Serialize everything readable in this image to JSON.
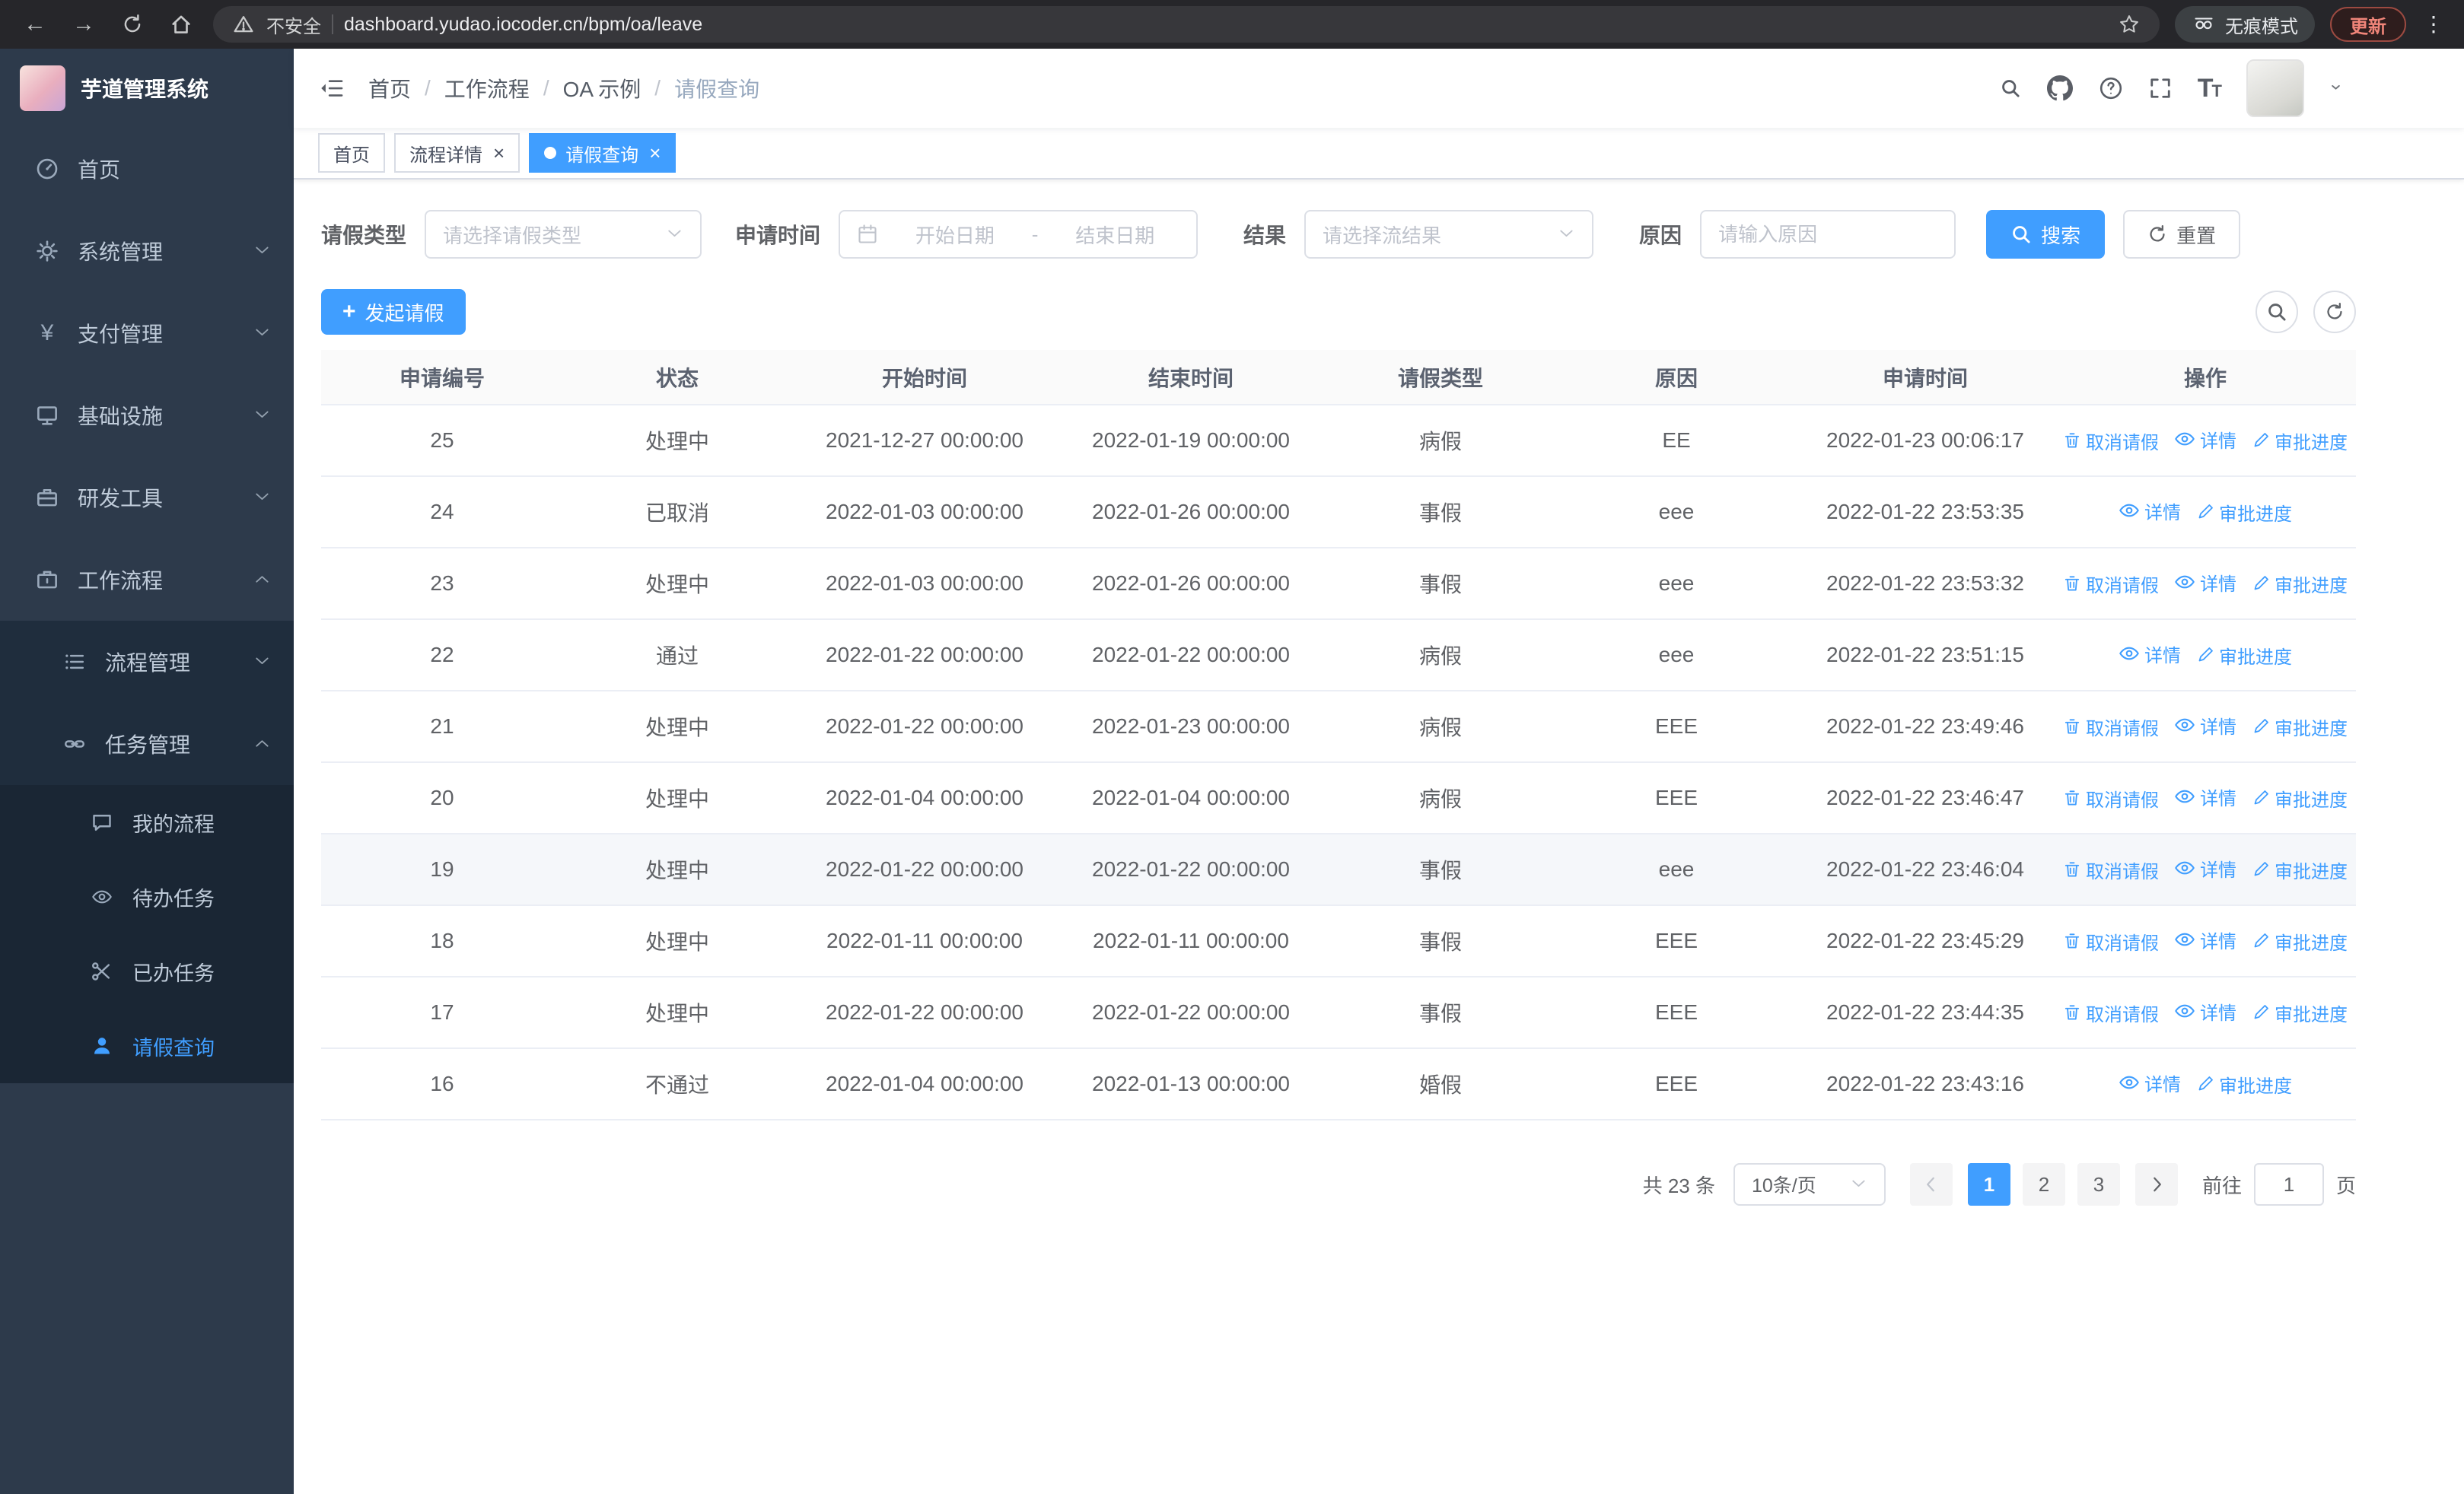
{
  "browser": {
    "security_warning": "不安全",
    "url": "dashboard.yudao.iocoder.cn/bpm/oa/leave",
    "incognito_label": "无痕模式",
    "update_label": "更新"
  },
  "sidebar": {
    "logo_title": "芋道管理系统",
    "menu": [
      {
        "key": "home",
        "label": "首页",
        "icon": "dashboard",
        "level": 1
      },
      {
        "key": "system",
        "label": "系统管理",
        "icon": "gear",
        "level": 1,
        "chevron": "down"
      },
      {
        "key": "payment",
        "label": "支付管理",
        "icon": "yen",
        "level": 1,
        "chevron": "down"
      },
      {
        "key": "infrastructure",
        "label": "基础设施",
        "icon": "monitor",
        "level": 1,
        "chevron": "down"
      },
      {
        "key": "dev-tools",
        "label": "研发工具",
        "icon": "toolbox",
        "level": 1,
        "chevron": "down"
      },
      {
        "key": "workflow",
        "label": "工作流程",
        "icon": "briefcase",
        "level": 1,
        "chevron": "up"
      },
      {
        "key": "process-mgmt",
        "label": "流程管理",
        "icon": "list",
        "level": 2,
        "chevron": "down"
      },
      {
        "key": "task-mgmt",
        "label": "任务管理",
        "icon": "link",
        "level": 2,
        "chevron": "up"
      },
      {
        "key": "my-process",
        "label": "我的流程",
        "icon": "chat",
        "level": 3
      },
      {
        "key": "todo-tasks",
        "label": "待办任务",
        "icon": "eye",
        "level": 3
      },
      {
        "key": "done-tasks",
        "label": "已办任务",
        "icon": "scissors",
        "level": 3
      },
      {
        "key": "leave-query",
        "label": "请假查询",
        "icon": "person",
        "level": 3,
        "active": true
      }
    ]
  },
  "header": {
    "breadcrumbs": [
      "首页",
      "工作流程",
      "OA 示例",
      "请假查询"
    ]
  },
  "tabs": [
    {
      "key": "home",
      "label": "首页",
      "closable": false,
      "active": false
    },
    {
      "key": "process-detail",
      "label": "流程详情",
      "closable": true,
      "active": false
    },
    {
      "key": "leave-query",
      "label": "请假查询",
      "closable": true,
      "active": true
    }
  ],
  "filters": {
    "leave_type_label": "请假类型",
    "leave_type_placeholder": "请选择请假类型",
    "apply_time_label": "申请时间",
    "start_date_placeholder": "开始日期",
    "range_separator": "-",
    "end_date_placeholder": "结束日期",
    "result_label": "结果",
    "result_placeholder": "请选择流结果",
    "reason_label": "原因",
    "reason_placeholder": "请输入原因",
    "search_label": "搜索",
    "reset_label": "重置"
  },
  "toolbar": {
    "create_label": "发起请假"
  },
  "table": {
    "columns": [
      "申请编号",
      "状态",
      "开始时间",
      "结束时间",
      "请假类型",
      "原因",
      "申请时间",
      "操作"
    ],
    "action_labels": {
      "cancel": "取消请假",
      "detail": "详情",
      "progress": "审批进度"
    },
    "rows": [
      {
        "id": "25",
        "status": "处理中",
        "start_time": "2021-12-27 00:00:00",
        "end_time": "2022-01-19 00:00:00",
        "leave_type": "病假",
        "reason": "EE",
        "apply_time": "2022-01-23 00:06:17",
        "actions": [
          "cancel",
          "detail",
          "progress"
        ]
      },
      {
        "id": "24",
        "status": "已取消",
        "start_time": "2022-01-03 00:00:00",
        "end_time": "2022-01-26 00:00:00",
        "leave_type": "事假",
        "reason": "eee",
        "apply_time": "2022-01-22 23:53:35",
        "actions": [
          "detail",
          "progress"
        ]
      },
      {
        "id": "23",
        "status": "处理中",
        "start_time": "2022-01-03 00:00:00",
        "end_time": "2022-01-26 00:00:00",
        "leave_type": "事假",
        "reason": "eee",
        "apply_time": "2022-01-22 23:53:32",
        "actions": [
          "cancel",
          "detail",
          "progress"
        ]
      },
      {
        "id": "22",
        "status": "通过",
        "start_time": "2022-01-22 00:00:00",
        "end_time": "2022-01-22 00:00:00",
        "leave_type": "病假",
        "reason": "eee",
        "apply_time": "2022-01-22 23:51:15",
        "actions": [
          "detail",
          "progress"
        ]
      },
      {
        "id": "21",
        "status": "处理中",
        "start_time": "2022-01-22 00:00:00",
        "end_time": "2022-01-23 00:00:00",
        "leave_type": "病假",
        "reason": "EEE",
        "apply_time": "2022-01-22 23:49:46",
        "actions": [
          "cancel",
          "detail",
          "progress"
        ]
      },
      {
        "id": "20",
        "status": "处理中",
        "start_time": "2022-01-04 00:00:00",
        "end_time": "2022-01-04 00:00:00",
        "leave_type": "病假",
        "reason": "EEE",
        "apply_time": "2022-01-22 23:46:47",
        "actions": [
          "cancel",
          "detail",
          "progress"
        ]
      },
      {
        "id": "19",
        "status": "处理中",
        "start_time": "2022-01-22 00:00:00",
        "end_time": "2022-01-22 00:00:00",
        "leave_type": "事假",
        "reason": "eee",
        "apply_time": "2022-01-22 23:46:04",
        "actions": [
          "cancel",
          "detail",
          "progress"
        ],
        "highlighted": true
      },
      {
        "id": "18",
        "status": "处理中",
        "start_time": "2022-01-11 00:00:00",
        "end_time": "2022-01-11 00:00:00",
        "leave_type": "事假",
        "reason": "EEE",
        "apply_time": "2022-01-22 23:45:29",
        "actions": [
          "cancel",
          "detail",
          "progress"
        ]
      },
      {
        "id": "17",
        "status": "处理中",
        "start_time": "2022-01-22 00:00:00",
        "end_time": "2022-01-22 00:00:00",
        "leave_type": "事假",
        "reason": "EEE",
        "apply_time": "2022-01-22 23:44:35",
        "actions": [
          "cancel",
          "detail",
          "progress"
        ]
      },
      {
        "id": "16",
        "status": "不通过",
        "start_time": "2022-01-04 00:00:00",
        "end_time": "2022-01-13 00:00:00",
        "leave_type": "婚假",
        "reason": "EEE",
        "apply_time": "2022-01-22 23:43:16",
        "actions": [
          "detail",
          "progress"
        ]
      }
    ]
  },
  "pagination": {
    "total_text": "共 23 条",
    "page_size": "10条/页",
    "pages": [
      "1",
      "2",
      "3"
    ],
    "current_page": "1",
    "goto_label": "前往",
    "goto_value": "1",
    "goto_suffix": "页"
  },
  "colors": {
    "primary": "#409eff",
    "sidebar_bg": "#2d3a4b",
    "sidebar_sub_bg": "#1f2d3d",
    "update_red": "#f08579"
  }
}
